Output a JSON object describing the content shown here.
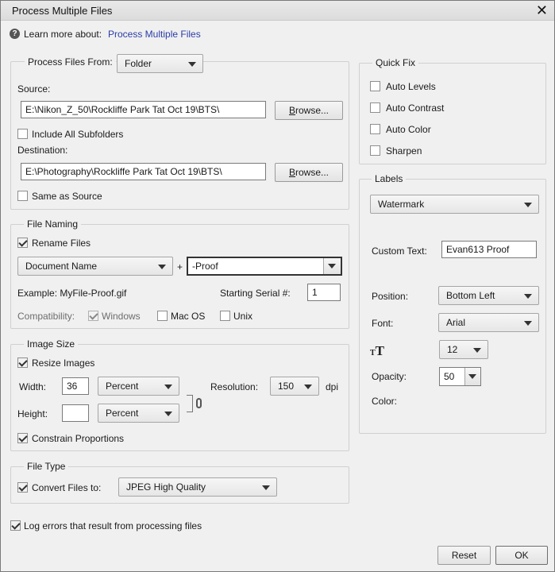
{
  "window": {
    "title": "Process Multiple Files",
    "close_glyph": "✕"
  },
  "help": {
    "prefix": "Learn more about:",
    "link": "Process Multiple Files",
    "icon": "help-icon"
  },
  "process": {
    "label": "Process Files From:",
    "from": "Folder",
    "source_label": "Source:",
    "source_value": "E:\\Nikon_Z_50\\Rockliffe Park Tat Oct 19\\BTS\\",
    "browse_label": "Browse...",
    "include_subfolders": "Include All Subfolders",
    "destination_label": "Destination:",
    "destination_value": "E:\\Photography\\Rockliffe Park Tat Oct 19\\BTS\\",
    "same_as_source": "Same as Source"
  },
  "naming": {
    "legend": "File Naming",
    "rename": "Rename Files",
    "name_option": "Document Name",
    "plus": "+",
    "suffix": "-Proof",
    "example": "Example: MyFile-Proof.gif",
    "serial_label": "Starting Serial #:",
    "serial_value": "1",
    "compat_label": "Compatibility:",
    "windows": "Windows",
    "macos": "Mac OS",
    "unix": "Unix"
  },
  "image_size": {
    "legend": "Image Size",
    "resize": "Resize Images",
    "width_label": "Width:",
    "width_value": "36",
    "width_unit": "Percent",
    "height_label": "Height:",
    "height_value": "",
    "height_unit": "Percent",
    "resolution_label": "Resolution:",
    "resolution_value": "150",
    "dpi": "dpi",
    "constrain": "Constrain Proportions"
  },
  "file_type": {
    "legend": "File Type",
    "convert": "Convert Files to:",
    "format": "JPEG High Quality"
  },
  "log_errors": "Log errors that result from processing files",
  "quick_fix": {
    "legend": "Quick Fix",
    "auto_levels": "Auto Levels",
    "auto_contrast": "Auto Contrast",
    "auto_color": "Auto Color",
    "sharpen": "Sharpen"
  },
  "labels": {
    "legend": "Labels",
    "type": "Watermark",
    "custom_text_label": "Custom Text:",
    "custom_text": "Evan613 Proof",
    "position_label": "Position:",
    "position": "Bottom Left",
    "font_label": "Font:",
    "font": "Arial",
    "size": "12",
    "opacity_label": "Opacity:",
    "opacity": "50",
    "color_label": "Color:"
  },
  "buttons": {
    "reset": "Reset",
    "ok": "OK"
  }
}
